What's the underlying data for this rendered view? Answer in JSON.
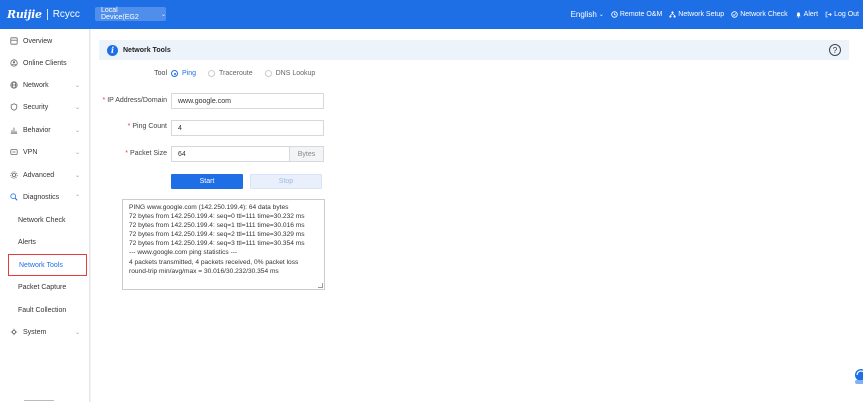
{
  "header": {
    "brand": "Ruijie",
    "product": "Rcycc",
    "device": "Local Device(EG2",
    "language": "English",
    "nav": [
      {
        "icon": "remote-icon",
        "label": "Remote O&M"
      },
      {
        "icon": "network-setup-icon",
        "label": "Network Setup"
      },
      {
        "icon": "network-check-icon",
        "label": "Network Check"
      },
      {
        "icon": "alert-icon",
        "label": "Alert"
      },
      {
        "icon": "logout-icon",
        "label": "Log Out"
      }
    ]
  },
  "sidebar": {
    "items": [
      {
        "label": "Overview",
        "icon": "overview-icon"
      },
      {
        "label": "Online Clients",
        "icon": "clients-icon"
      },
      {
        "label": "Network",
        "icon": "globe-icon"
      },
      {
        "label": "Security",
        "icon": "shield-icon"
      },
      {
        "label": "Behavior",
        "icon": "chart-icon"
      },
      {
        "label": "VPN",
        "icon": "vpn-icon"
      },
      {
        "label": "Advanced",
        "icon": "gear-icon"
      },
      {
        "label": "Diagnostics",
        "icon": "diagnostics-icon"
      },
      {
        "label": "System",
        "icon": "system-icon"
      }
    ],
    "sub_items": [
      "Network Check",
      "Alerts",
      "Network Tools",
      "Packet Capture",
      "Fault Collection"
    ]
  },
  "tool": {
    "section_title": "Network Tools",
    "tool_label": "Tool",
    "options": [
      "Ping",
      "Traceroute",
      "DNS Lookup"
    ],
    "selected": "Ping",
    "address_label": "IP Address/Domain",
    "address_value": "www.google.com",
    "count_label": "Ping Count",
    "count_value": "4",
    "size_label": "Packet Size",
    "size_value": "64",
    "size_unit": "Bytes",
    "start_label": "Start",
    "stop_label": "Stop",
    "output": [
      "PING www.google.com (142.250.199.4): 64 data bytes",
      "72 bytes from 142.250.199.4: seq=0 ttl=111 time=30.232 ms",
      "72 bytes from 142.250.199.4: seq=1 ttl=111 time=30.016 ms",
      "72 bytes from 142.250.199.4: seq=2 ttl=111 time=30.329 ms",
      "72 bytes from 142.250.199.4: seq=3 ttl=111 time=30.354 ms",
      "",
      "--- www.google.com ping statistics ---",
      "4 packets transmitted, 4 packets received, 0% packet loss",
      "round-trip min/avg/max = 30.016/30.232/30.354 ms"
    ]
  },
  "colors": {
    "primary": "#1e6fe6",
    "active_outline": "#e43d3d"
  }
}
